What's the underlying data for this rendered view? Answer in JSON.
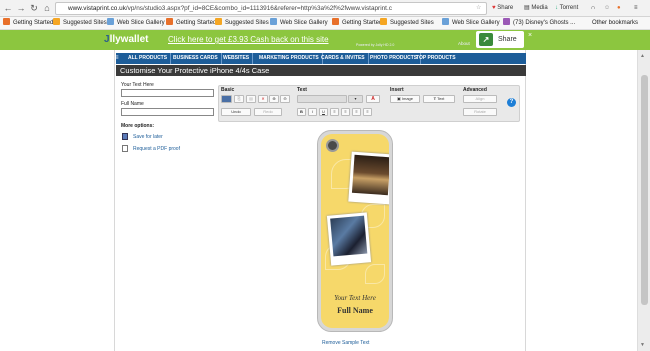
{
  "browser": {
    "url_prefix": "www.vistaprint.co.uk",
    "url_rest": "/vp/ns/studio3.aspx?pf_id=8CE&combo_id=1113916&referer=http%3a%2f%2fwww.vistaprint.c",
    "share_label": "Share",
    "media_label": "Media",
    "torrent_label": "Torrent"
  },
  "bookmarks": [
    {
      "label": "Getting Started",
      "color": "#e8702a"
    },
    {
      "label": "Suggested Sites",
      "color": "#f5a623"
    },
    {
      "label": "Web Slice Gallery",
      "color": "#6aa1d8"
    },
    {
      "label": "Getting Started",
      "color": "#e8702a"
    },
    {
      "label": "Suggested Sites",
      "color": "#f5a623"
    },
    {
      "label": "Web Slice Gallery",
      "color": "#6aa1d8"
    },
    {
      "label": "Getting Started",
      "color": "#e8702a"
    },
    {
      "label": "Suggested Sites",
      "color": "#f5a623"
    },
    {
      "label": "Web Slice Gallery",
      "color": "#6aa1d8"
    },
    {
      "label": "(73) Disney's Ghosts ...",
      "color": "#9b59b6"
    }
  ],
  "other_bookmarks": "Other bookmarks",
  "jollywallet": {
    "logo_a": "J",
    "logo_b": "llywallet",
    "cashback_link": "Click here to get £3.93 Cash back on this site",
    "powered": "Powered by Jolly HD 2.0",
    "about": "About",
    "share": "Share"
  },
  "nav": [
    "ALL PRODUCTS",
    "BUSINESS CARDS",
    "WEBSITES",
    "MARKETING PRODUCTS",
    "CARDS & INVITES",
    "PHOTO PRODUCTS",
    "TOP PRODUCTS"
  ],
  "page_title": "Customise Your Protective iPhone 4/4s Case",
  "form": {
    "your_text_label": "Your Text Here",
    "full_name_label": "Full Name",
    "more_options": "More options:",
    "save_later": "Save for later",
    "pdf_proof": "Request a PDF proof"
  },
  "toolbar": {
    "basic": "Basic",
    "text": "Text",
    "insert": "Insert",
    "advanced": "Advanced",
    "undo": "Undo",
    "redo": "Redo",
    "image": "Image",
    "text_btn": "Text",
    "align": "Align",
    "rotate": "Rotate",
    "format_buttons": [
      "B",
      "I",
      "U"
    ]
  },
  "case": {
    "your_text": "Your Text Here",
    "full_name": "Full Name"
  },
  "remove_sample": "Remove Sample Text",
  "colors": {
    "accent": "#1d5d99",
    "jolly_green": "#8cc63f",
    "case_yellow": "#f6d86a"
  }
}
